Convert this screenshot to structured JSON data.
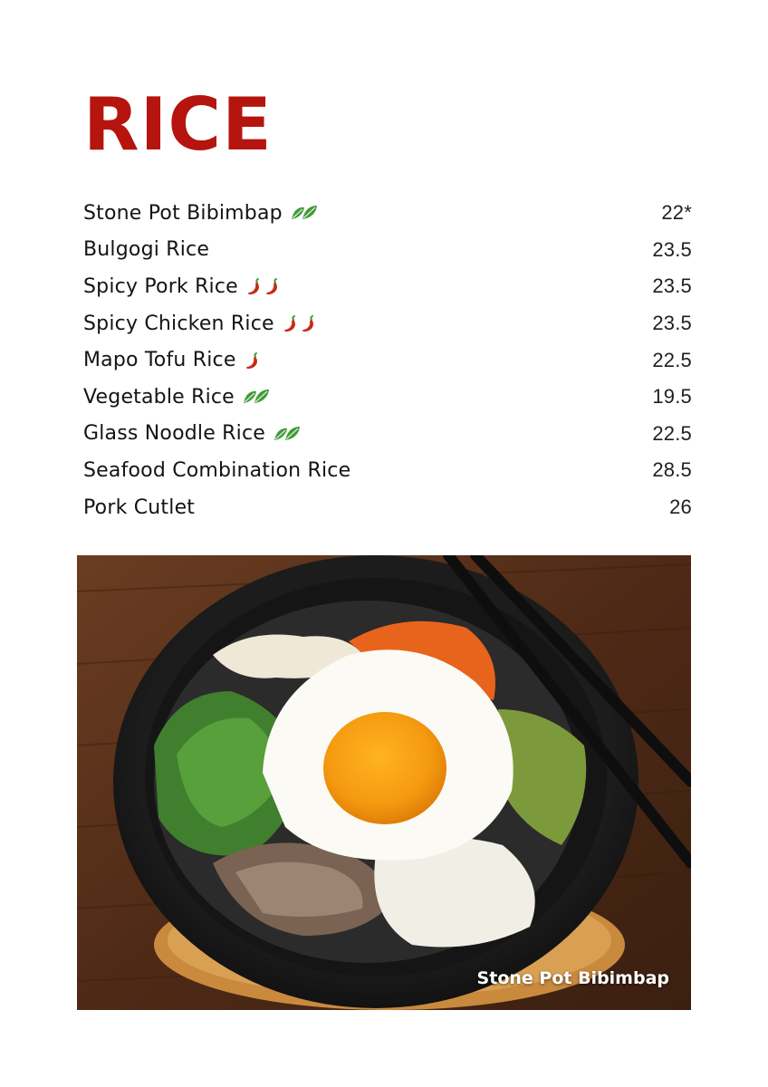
{
  "title": "RICE",
  "colors": {
    "title": "#b5140f",
    "leaf": "#3f9b37",
    "chili": "#c62a1a"
  },
  "menu": [
    {
      "name": "Stone Pot Bibimbap",
      "price": "22*",
      "icons": [
        "leaf-icon"
      ]
    },
    {
      "name": "Bulgogi Rice",
      "price": "23.5",
      "icons": []
    },
    {
      "name": "Spicy Pork Rice",
      "price": "23.5",
      "icons": [
        "chili-icon",
        "chili-icon"
      ]
    },
    {
      "name": "Spicy Chicken Rice",
      "price": "23.5",
      "icons": [
        "chili-icon",
        "chili-icon"
      ]
    },
    {
      "name": "Mapo Tofu Rice",
      "price": "22.5",
      "icons": [
        "chili-icon"
      ]
    },
    {
      "name": "Vegetable Rice",
      "price": "19.5",
      "icons": [
        "leaf-icon"
      ]
    },
    {
      "name": "Glass Noodle Rice",
      "price": "22.5",
      "icons": [
        "leaf-icon"
      ]
    },
    {
      "name": "Seafood Combination Rice",
      "price": "28.5",
      "icons": []
    },
    {
      "name": "Pork Cutlet",
      "price": "26",
      "icons": []
    }
  ],
  "photo": {
    "caption": "Stone Pot Bibimbap"
  }
}
